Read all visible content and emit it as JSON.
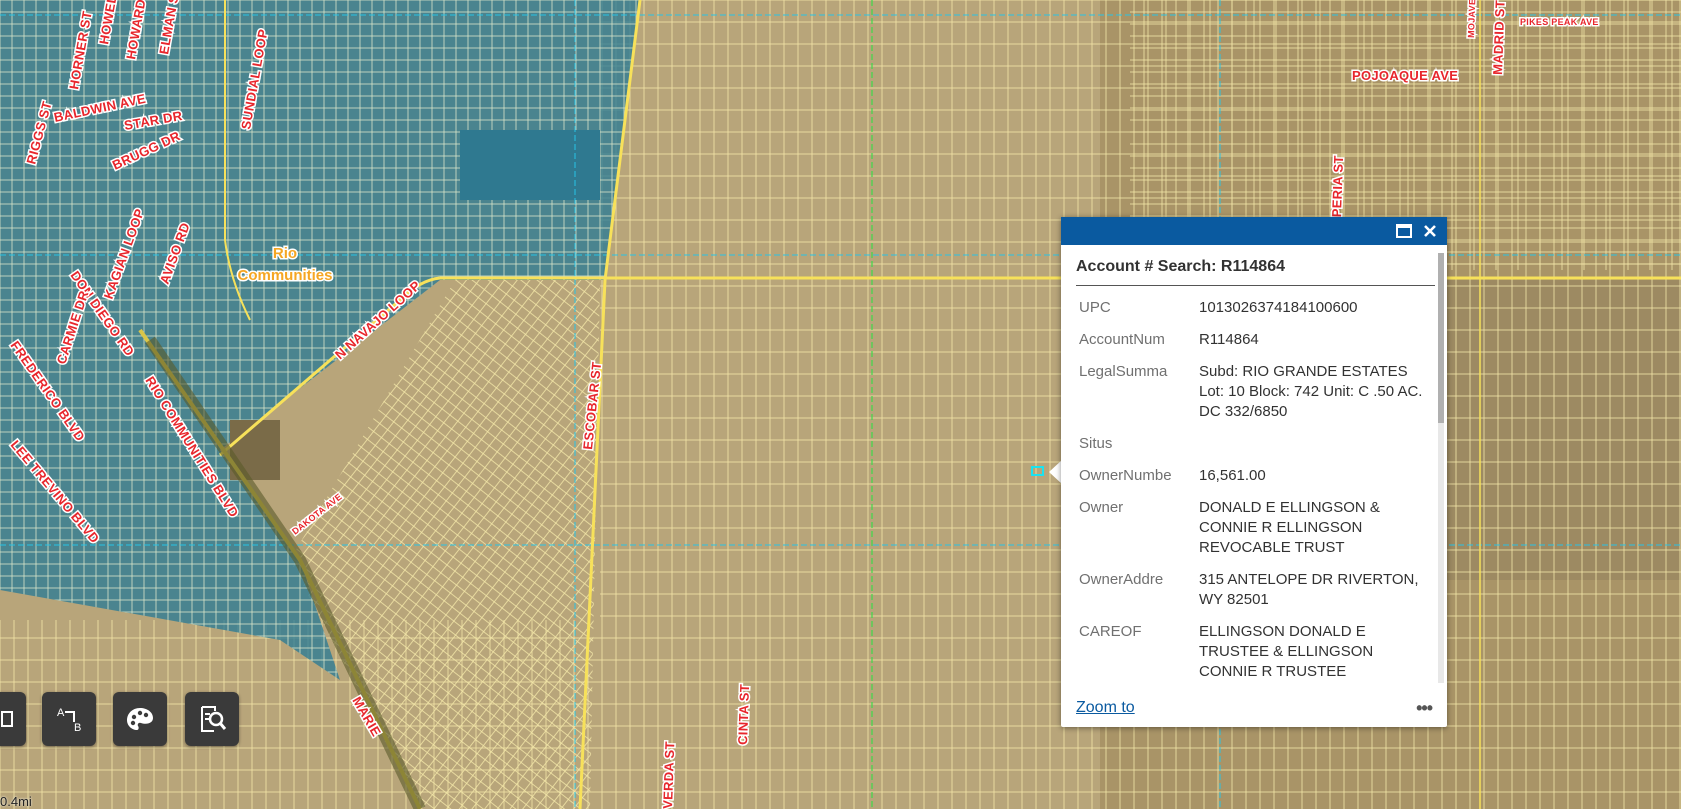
{
  "map": {
    "place_label_line1": "Rio",
    "place_label_line2": "Communities",
    "roads": {
      "horner": "HORNER ST",
      "howell": "HOWELL ST",
      "howard": "HOWARD ST",
      "elman": "ELMAN ST",
      "sundial": "SUNDIAL LOOP",
      "riggs": "RIGGS ST",
      "baldwin": "BALDWIN AVE",
      "star": "STAR DR",
      "brugg": "BRUGG DR",
      "kagian": "KAGIAN LOOP",
      "aviso": "AVISO RD",
      "don_diego": "DON DIEGO RD",
      "carmie": "CARMIE DR",
      "frederico": "FREDERICO BLVD",
      "lee_trevino": "LEE TREVINO BLVD",
      "rio_communities": "RIO COMMUNITIES BLVD",
      "n_navajo": "N NAVAJO LOOP",
      "escobar": "ESCOBAR ST",
      "dakota": "DAKOTA AVE",
      "marie": "MARIE",
      "cinta": "CINTA ST",
      "verda": "VERDA ST",
      "hesperia": "HESPERIA ST",
      "pojoaque": "POJOAQUE AVE",
      "pikes_peak": "PIKES PEAK AVE",
      "mojave": "MOJAVE",
      "madrid": "MADRID ST"
    },
    "scale_label": "0.4mi",
    "colors": {
      "parcel_line": "#f3e6a8",
      "road_major": "#f7e15a",
      "grid_blue": "#27c3e6",
      "grid_green": "#3fd94a",
      "city_overlay": "#2b7b95",
      "terrain": "#b8a57a"
    }
  },
  "toolbar": [
    {
      "name": "layer-list-button",
      "icon": "layers-icon"
    },
    {
      "name": "draw-button",
      "icon": "text-draw-icon",
      "label": "A B"
    },
    {
      "name": "basemap-gallery-button",
      "icon": "palette-icon"
    },
    {
      "name": "search-tool-button",
      "icon": "document-search-icon"
    }
  ],
  "popup": {
    "title": "Account # Search: R114864",
    "maximize_icon": "maximize-icon",
    "close_icon": "close-icon",
    "fields": [
      {
        "key": "UPC",
        "value": "1013026374184100600"
      },
      {
        "key": "AccountNum",
        "value": "R114864"
      },
      {
        "key": "LegalSumma",
        "value": "Subd: RIO GRANDE ESTATES Lot: 10 Block: 742 Unit: C .50 AC. DC 332/6850"
      },
      {
        "key": "Situs",
        "value": ""
      },
      {
        "key": "OwnerNumbe",
        "value": "16,561.00"
      },
      {
        "key": "Owner",
        "value": "DONALD E ELLINGSON & CONNIE R ELLINGSON REVOCABLE TRUST"
      },
      {
        "key": "OwnerAddre",
        "value": "315 ANTELOPE DR RIVERTON, WY 82501"
      },
      {
        "key": "CAREOF",
        "value": "ELLINGSON DONALD E TRUSTEE & ELLINGSON CONNIE R TRUSTEE"
      },
      {
        "key": "BusinessNa",
        "value": ""
      }
    ],
    "zoom_to": "Zoom to",
    "more": "•••"
  }
}
